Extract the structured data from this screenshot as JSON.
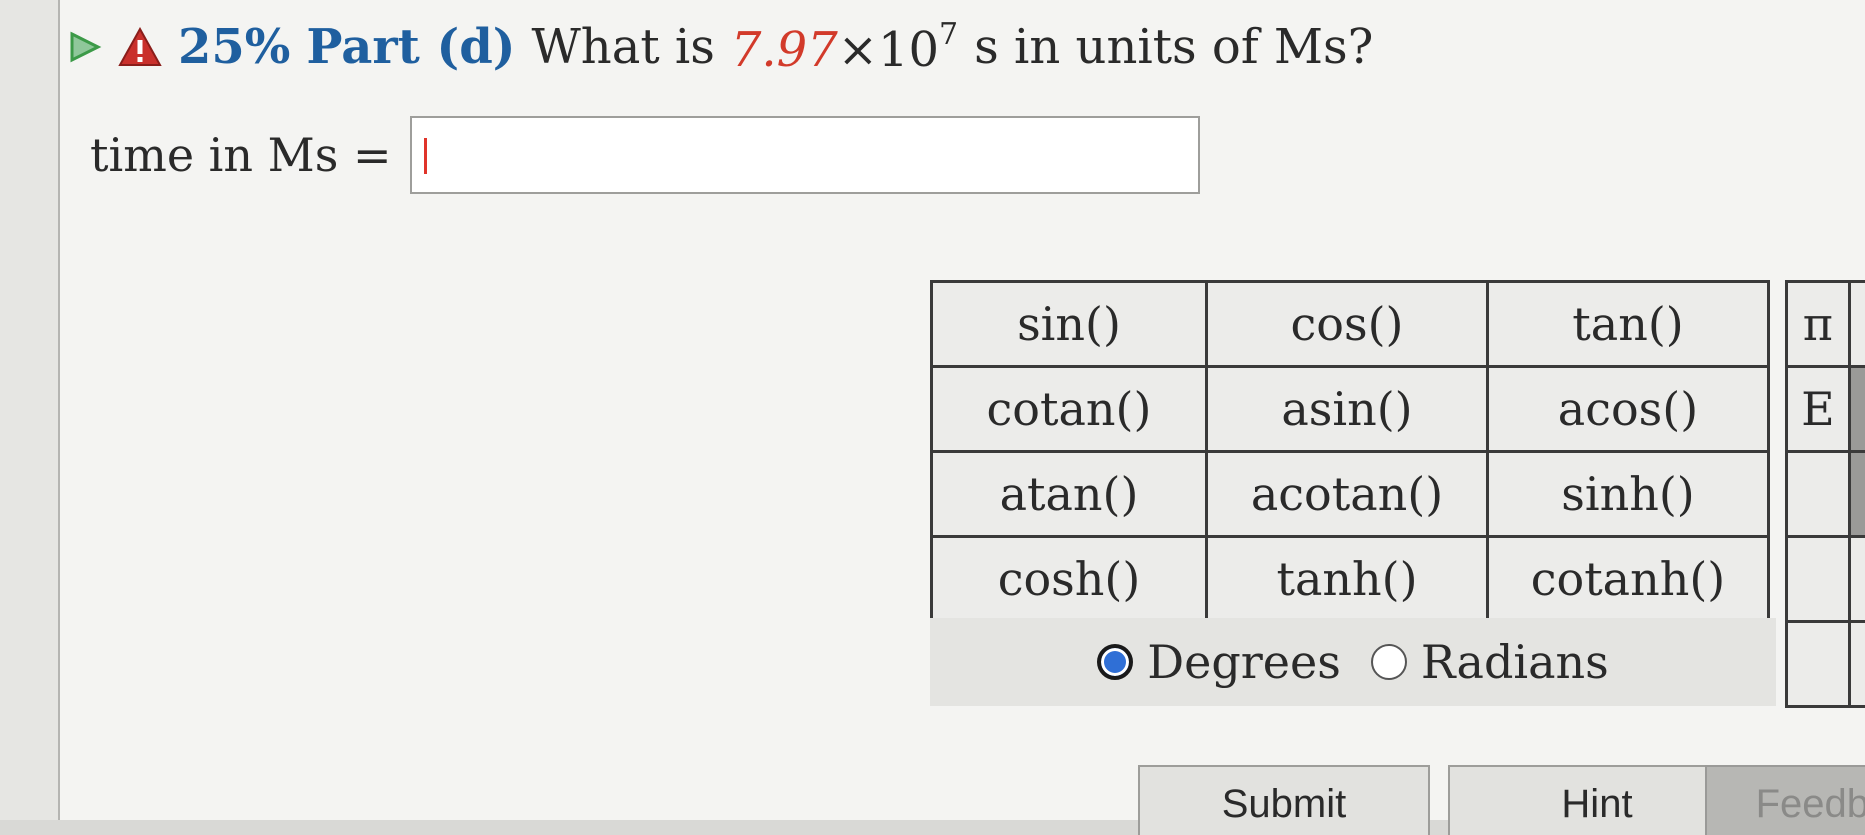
{
  "header": {
    "percent": "25%",
    "part": "Part (d)",
    "question_prefix": "What is",
    "mantissa": "7.97",
    "times": "×10",
    "exponent": "7",
    "question_suffix": "s in units of Ms?"
  },
  "answer": {
    "label": "time in Ms =",
    "value": ""
  },
  "functions": [
    [
      "sin()",
      "cos()",
      "tan()"
    ],
    [
      "cotan()",
      "asin()",
      "acos()"
    ],
    [
      "atan()",
      "acotan()",
      "sinh()"
    ],
    [
      "cosh()",
      "tanh()",
      "cotanh()"
    ]
  ],
  "constants": [
    "π",
    "E",
    "",
    "",
    ""
  ],
  "angle_mode": {
    "options": [
      "Degrees",
      "Radians"
    ],
    "selected": "Degrees"
  },
  "buttons": {
    "submit": "Submit",
    "hint": "Hint",
    "feedback": "Feedb"
  },
  "colors": {
    "part_blue": "#1f5f9f",
    "number_red": "#d23a2a",
    "warning_red": "#c9302c",
    "play_green": "#3c9a48",
    "radio_blue": "#2f6fd6"
  }
}
